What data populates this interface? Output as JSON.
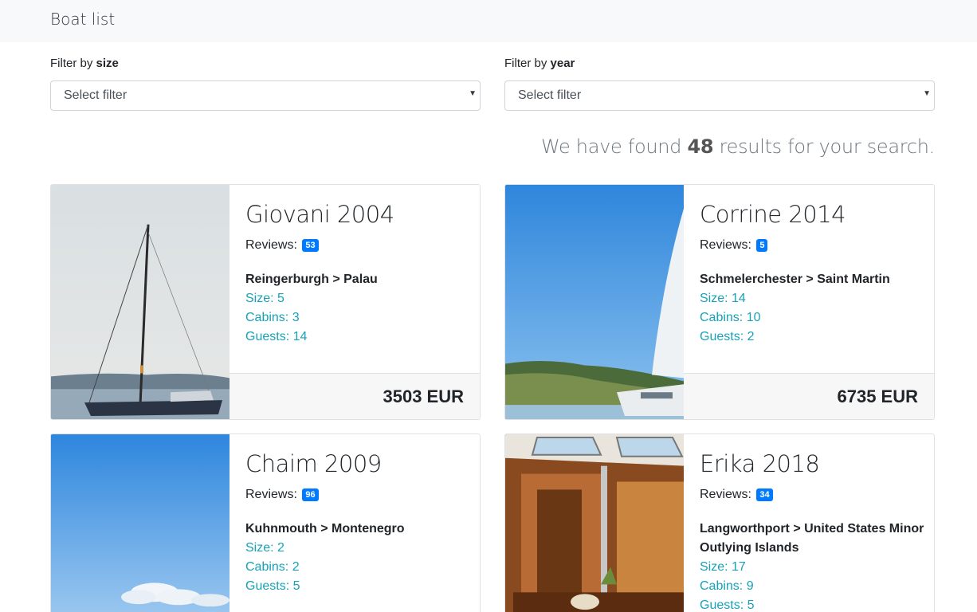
{
  "header": {
    "title": "Boat list"
  },
  "filters": {
    "size": {
      "label_prefix": "Filter by ",
      "label_key": "size",
      "selected": "Select filter"
    },
    "year": {
      "label_prefix": "Filter by ",
      "label_key": "year",
      "selected": "Select filter"
    }
  },
  "results": {
    "prefix": "We have found ",
    "count": "48",
    "suffix": " results for your search."
  },
  "boats": [
    {
      "title": "Giovani 2004",
      "reviews_label": "Reviews:",
      "reviews": "53",
      "route": "Reingerburgh > Palau",
      "size": "Size: 5",
      "cabins": "Cabins: 3",
      "guests": "Guests: 14",
      "price": "3503 EUR"
    },
    {
      "title": "Corrine 2014",
      "reviews_label": "Reviews:",
      "reviews": "5",
      "route": "Schmelerchester > Saint Martin",
      "size": "Size: 14",
      "cabins": "Cabins: 10",
      "guests": "Guests: 2",
      "price": "6735 EUR"
    },
    {
      "title": "Chaim 2009",
      "reviews_label": "Reviews:",
      "reviews": "96",
      "route": "Kuhnmouth > Montenegro",
      "size": "Size: 2",
      "cabins": "Cabins: 2",
      "guests": "Guests: 5"
    },
    {
      "title": "Erika 2018",
      "reviews_label": "Reviews:",
      "reviews": "34",
      "route": "Langworthport > United States Minor Outlying Islands",
      "size": "Size: 17",
      "cabins": "Cabins: 9",
      "guests": "Guests: 5"
    }
  ],
  "colors": {
    "accent": "#007bff",
    "spec": "#17a2b8"
  }
}
